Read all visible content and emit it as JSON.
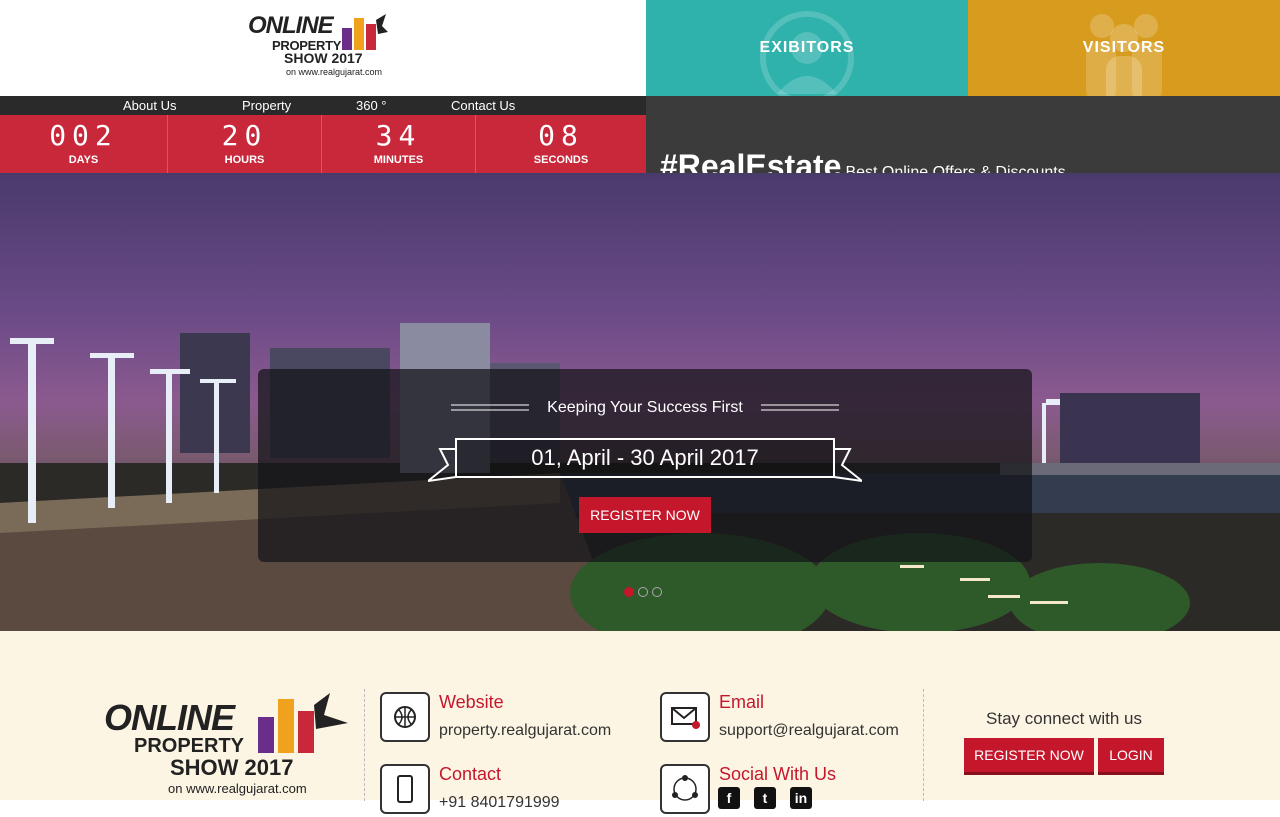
{
  "header": {
    "logo": {
      "line1": "ONLINE",
      "line2": "PROPERTY",
      "line3": "SHOW 2017",
      "line4": "on www.realgujarat.com"
    },
    "nav": [
      "About Us",
      "Property",
      "360 °",
      "Contact Us"
    ],
    "tiles": {
      "exhibitors": "EXIBITORS",
      "visitors": "VISITORS"
    },
    "countdown": [
      {
        "value": "002",
        "unit": "DAYS"
      },
      {
        "value": "20",
        "unit": "HOURS"
      },
      {
        "value": "34",
        "unit": "MINUTES"
      },
      {
        "value": "08",
        "unit": "SECONDS"
      }
    ],
    "hashtag": "#RealEstate",
    "hashtag_sub": "Best Online Offers & Discounts"
  },
  "hero": {
    "tagline": "Keeping Your Success First",
    "dates": "01, April - 30 April 2017",
    "register_label": "REGISTER NOW",
    "slides": 3,
    "active_slide": 1
  },
  "footer": {
    "logo": {
      "line1": "ONLINE",
      "line2": "PROPERTY",
      "line3": "SHOW 2017",
      "line4": "on www.realgujarat.com"
    },
    "website": {
      "heading": "Website",
      "value": "property.realgujarat.com"
    },
    "email": {
      "heading": "Email",
      "value": "support@realgujarat.com"
    },
    "contact": {
      "heading": "Contact",
      "value": "+91 8401791999"
    },
    "social": {
      "heading": "Social With Us",
      "icons": [
        "facebook-icon",
        "twitter-icon",
        "linkedin-icon"
      ]
    },
    "stay": "Stay connect with us",
    "register_label": "REGISTER NOW",
    "login_label": "LOGIN"
  },
  "colors": {
    "red": "#c4172c",
    "teal": "#2fb1ac",
    "gold": "#d79b1e",
    "cream": "#fdf5e4"
  }
}
